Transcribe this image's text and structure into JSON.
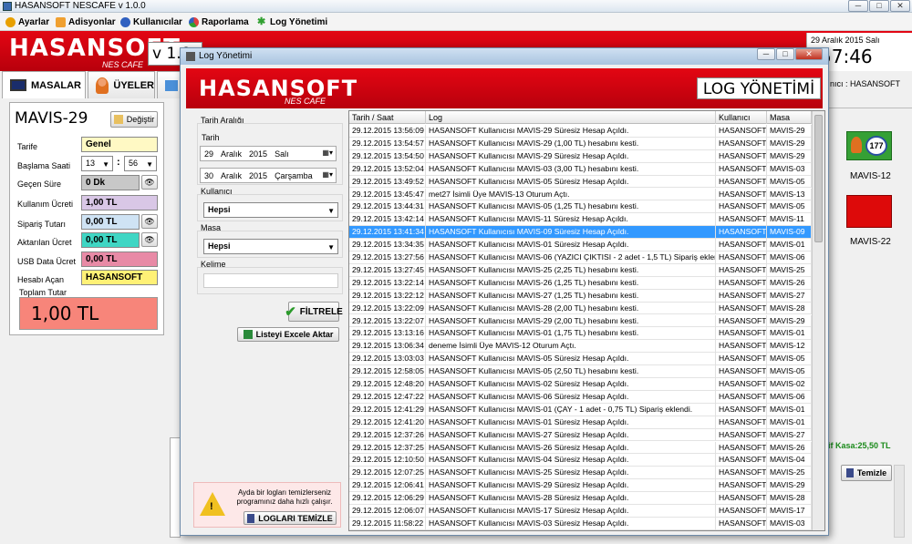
{
  "app": {
    "title": "HASANSOFT NESCAFE v 1.0.0",
    "version": "v 1.0",
    "brand": "HASANSOFT",
    "brand_sub": "NES CAFE",
    "date": "29 Aralık 2015 Salı",
    "time": "57:46"
  },
  "menu": [
    {
      "label": "Ayarlar",
      "icon": "gear-icon",
      "color": "#e8a000"
    },
    {
      "label": "Adisyonlar",
      "icon": "receipt-icon",
      "color": "#f0a030"
    },
    {
      "label": "Kullanıcılar",
      "icon": "users-icon",
      "color": "#3060c0"
    },
    {
      "label": "Raporlama",
      "icon": "chart-icon",
      "color": "#e04040"
    },
    {
      "label": "Log Yönetimi",
      "icon": "log-icon",
      "color": "#30a030"
    }
  ],
  "tabs": [
    {
      "label": "MASALAR"
    },
    {
      "label": "ÜYELER"
    }
  ],
  "left": {
    "table_name": "MAVIS-29",
    "change_label": "Değiştir",
    "tariff_label": "Tarife",
    "tariff": "Genel",
    "start_label": "Başlama Saati",
    "hour": "13",
    "minute": "56",
    "elapsed_label": "Geçen Süre",
    "elapsed": "0 Dk",
    "usage_label": "Kullanım Ücreti",
    "usage": "1,00 TL",
    "order_label": "Sipariş Tutarı",
    "order": "0,00 TL",
    "transfer_label": "Aktarılan Ücret",
    "transfer": "0,00 TL",
    "usb_label": "USB Data Ücret",
    "usb": "0,00 TL",
    "opener_label": "Hesabı Açan",
    "opener": "HASANSOFT",
    "total_label": "Toplam Tutar",
    "total": "1,00 TL"
  },
  "right": {
    "user_text": "nıcı : HASANSOFT",
    "table1": "MAVIS-12",
    "badge": "177",
    "table2": "MAVIS-22",
    "kasa": "if Kasa:25,50 TL",
    "clear": "Temizle"
  },
  "dialog": {
    "title": "Log Yönetimi",
    "header": "LOG YÖNETİMİ",
    "date_range": "Tarih Aralığı",
    "date_label": "Tarih",
    "d1": {
      "day": "29",
      "month": "Aralık",
      "year": "2015",
      "dow": "Salı"
    },
    "d2": {
      "day": "30",
      "month": "Aralık",
      "year": "2015",
      "dow": "Çarşamba"
    },
    "user_label": "Kullanıcı",
    "user_value": "Hepsi",
    "table_label": "Masa",
    "table_value": "Hepsi",
    "word_label": "Kelime",
    "word_value": "",
    "filter_btn": "FİLTRELE",
    "excel_btn": "Listeyi Excele Aktar",
    "warning": "Ayda bir logları temizlerseniz programınız daha hızlı çalışır.",
    "clear_btn": "LOGLARI TEMİZLE"
  },
  "grid": {
    "columns": [
      "Tarih / Saat",
      "Log",
      "Kullanıcı",
      "Masa"
    ],
    "rows": [
      [
        "29.12.2015 13:56:09",
        "HASANSOFT Kullanıcısı MAVIS-29 Süresiz Hesap Açıldı.",
        "HASANSOFT",
        "MAVIS-29"
      ],
      [
        "29.12.2015 13:54:57",
        "HASANSOFT Kullanıcısı MAVIS-29 (1,00 TL) hesabını kesti.",
        "HASANSOFT",
        "MAVIS-29"
      ],
      [
        "29.12.2015 13:54:50",
        "HASANSOFT Kullanıcısı MAVIS-29 Süresiz Hesap Açıldı.",
        "HASANSOFT",
        "MAVIS-29"
      ],
      [
        "29.12.2015 13:52:04",
        "HASANSOFT Kullanıcısı MAVIS-03 (3,00 TL) hesabını kesti.",
        "HASANSOFT",
        "MAVIS-03"
      ],
      [
        "29.12.2015 13:49:52",
        "HASANSOFT Kullanıcısı MAVIS-05 Süresiz Hesap Açıldı.",
        "HASANSOFT",
        "MAVIS-05"
      ],
      [
        "29.12.2015 13:45:47",
        "met27 İsimli Üye MAVIS-13  Oturum Açtı.",
        "HASANSOFT",
        "MAVIS-13"
      ],
      [
        "29.12.2015 13:44:31",
        "HASANSOFT Kullanıcısı MAVIS-05 (1,25 TL) hesabını kesti.",
        "HASANSOFT",
        "MAVIS-05"
      ],
      [
        "29.12.2015 13:42:14",
        "HASANSOFT Kullanıcısı MAVIS-11 Süresiz Hesap Açıldı.",
        "HASANSOFT",
        "MAVIS-11"
      ],
      [
        "29.12.2015 13:41:34",
        "HASANSOFT Kullanıcısı MAVIS-09 Süresiz Hesap Açıldı.",
        "HASANSOFT",
        "MAVIS-09"
      ],
      [
        "29.12.2015 13:34:35",
        "HASANSOFT Kullanıcısı MAVIS-01 Süresiz Hesap Açıldı.",
        "HASANSOFT",
        "MAVIS-01"
      ],
      [
        "29.12.2015 13:27:56",
        "HASANSOFT Kullanıcısı MAVIS-06 (YAZICI ÇIKTISI - 2 adet - 1,5 TL) Sipariş eklendi.",
        "HASANSOFT",
        "MAVIS-06"
      ],
      [
        "29.12.2015 13:27:45",
        "HASANSOFT Kullanıcısı MAVIS-25 (2,25 TL) hesabını kesti.",
        "HASANSOFT",
        "MAVIS-25"
      ],
      [
        "29.12.2015 13:22:14",
        "HASANSOFT Kullanıcısı MAVIS-26 (1,25 TL) hesabını kesti.",
        "HASANSOFT",
        "MAVIS-26"
      ],
      [
        "29.12.2015 13:22:12",
        "HASANSOFT Kullanıcısı MAVIS-27 (1,25 TL) hesabını kesti.",
        "HASANSOFT",
        "MAVIS-27"
      ],
      [
        "29.12.2015 13:22:09",
        "HASANSOFT Kullanıcısı MAVIS-28 (2,00 TL) hesabını kesti.",
        "HASANSOFT",
        "MAVIS-28"
      ],
      [
        "29.12.2015 13:22:07",
        "HASANSOFT Kullanıcısı MAVIS-29 (2,00 TL) hesabını kesti.",
        "HASANSOFT",
        "MAVIS-29"
      ],
      [
        "29.12.2015 13:13:16",
        "HASANSOFT Kullanıcısı MAVIS-01 (1,75 TL) hesabını kesti.",
        "HASANSOFT",
        "MAVIS-01"
      ],
      [
        "29.12.2015 13:06:34",
        "deneme İsimli Üye MAVIS-12  Oturum Açtı.",
        "HASANSOFT",
        "MAVIS-12"
      ],
      [
        "29.12.2015 13:03:03",
        "HASANSOFT Kullanıcısı MAVIS-05 Süresiz Hesap Açıldı.",
        "HASANSOFT",
        "MAVIS-05"
      ],
      [
        "29.12.2015 12:58:05",
        "HASANSOFT Kullanıcısı MAVIS-05 (2,50 TL) hesabını kesti.",
        "HASANSOFT",
        "MAVIS-05"
      ],
      [
        "29.12.2015 12:48:20",
        "HASANSOFT Kullanıcısı MAVIS-02 Süresiz Hesap Açıldı.",
        "HASANSOFT",
        "MAVIS-02"
      ],
      [
        "29.12.2015 12:47:22",
        "HASANSOFT Kullanıcısı MAVIS-06 Süresiz Hesap Açıldı.",
        "HASANSOFT",
        "MAVIS-06"
      ],
      [
        "29.12.2015 12:41:29",
        "HASANSOFT Kullanıcısı MAVIS-01 (ÇAY - 1 adet - 0,75 TL) Sipariş eklendi.",
        "HASANSOFT",
        "MAVIS-01"
      ],
      [
        "29.12.2015 12:41:20",
        "HASANSOFT Kullanıcısı MAVIS-01 Süresiz Hesap Açıldı.",
        "HASANSOFT",
        "MAVIS-01"
      ],
      [
        "29.12.2015 12:37:26",
        "HASANSOFT Kullanıcısı MAVIS-27 Süresiz Hesap Açıldı.",
        "HASANSOFT",
        "MAVIS-27"
      ],
      [
        "29.12.2015 12:37:25",
        "HASANSOFT Kullanıcısı MAVIS-26 Süresiz Hesap Açıldı.",
        "HASANSOFT",
        "MAVIS-26"
      ],
      [
        "29.12.2015 12:10:50",
        "HASANSOFT Kullanıcısı MAVIS-04 Süresiz Hesap Açıldı.",
        "HASANSOFT",
        "MAVIS-04"
      ],
      [
        "29.12.2015 12:07:25",
        "HASANSOFT Kullanıcısı MAVIS-25 Süresiz Hesap Açıldı.",
        "HASANSOFT",
        "MAVIS-25"
      ],
      [
        "29.12.2015 12:06:41",
        "HASANSOFT Kullanıcısı MAVIS-29 Süresiz Hesap Açıldı.",
        "HASANSOFT",
        "MAVIS-29"
      ],
      [
        "29.12.2015 12:06:29",
        "HASANSOFT Kullanıcısı MAVIS-28 Süresiz Hesap Açıldı.",
        "HASANSOFT",
        "MAVIS-28"
      ],
      [
        "29.12.2015 12:06:07",
        "HASANSOFT Kullanıcısı MAVIS-17 Süresiz Hesap Açıldı.",
        "HASANSOFT",
        "MAVIS-17"
      ],
      [
        "29.12.2015 11:58:22",
        "HASANSOFT Kullanıcısı MAVIS-03 Süresiz Hesap Açıldı.",
        "HASANSOFT",
        "MAVIS-03"
      ]
    ],
    "selected_index": 8
  },
  "colors": {
    "brand_red": "#e30613",
    "selection": "#3399ff"
  }
}
